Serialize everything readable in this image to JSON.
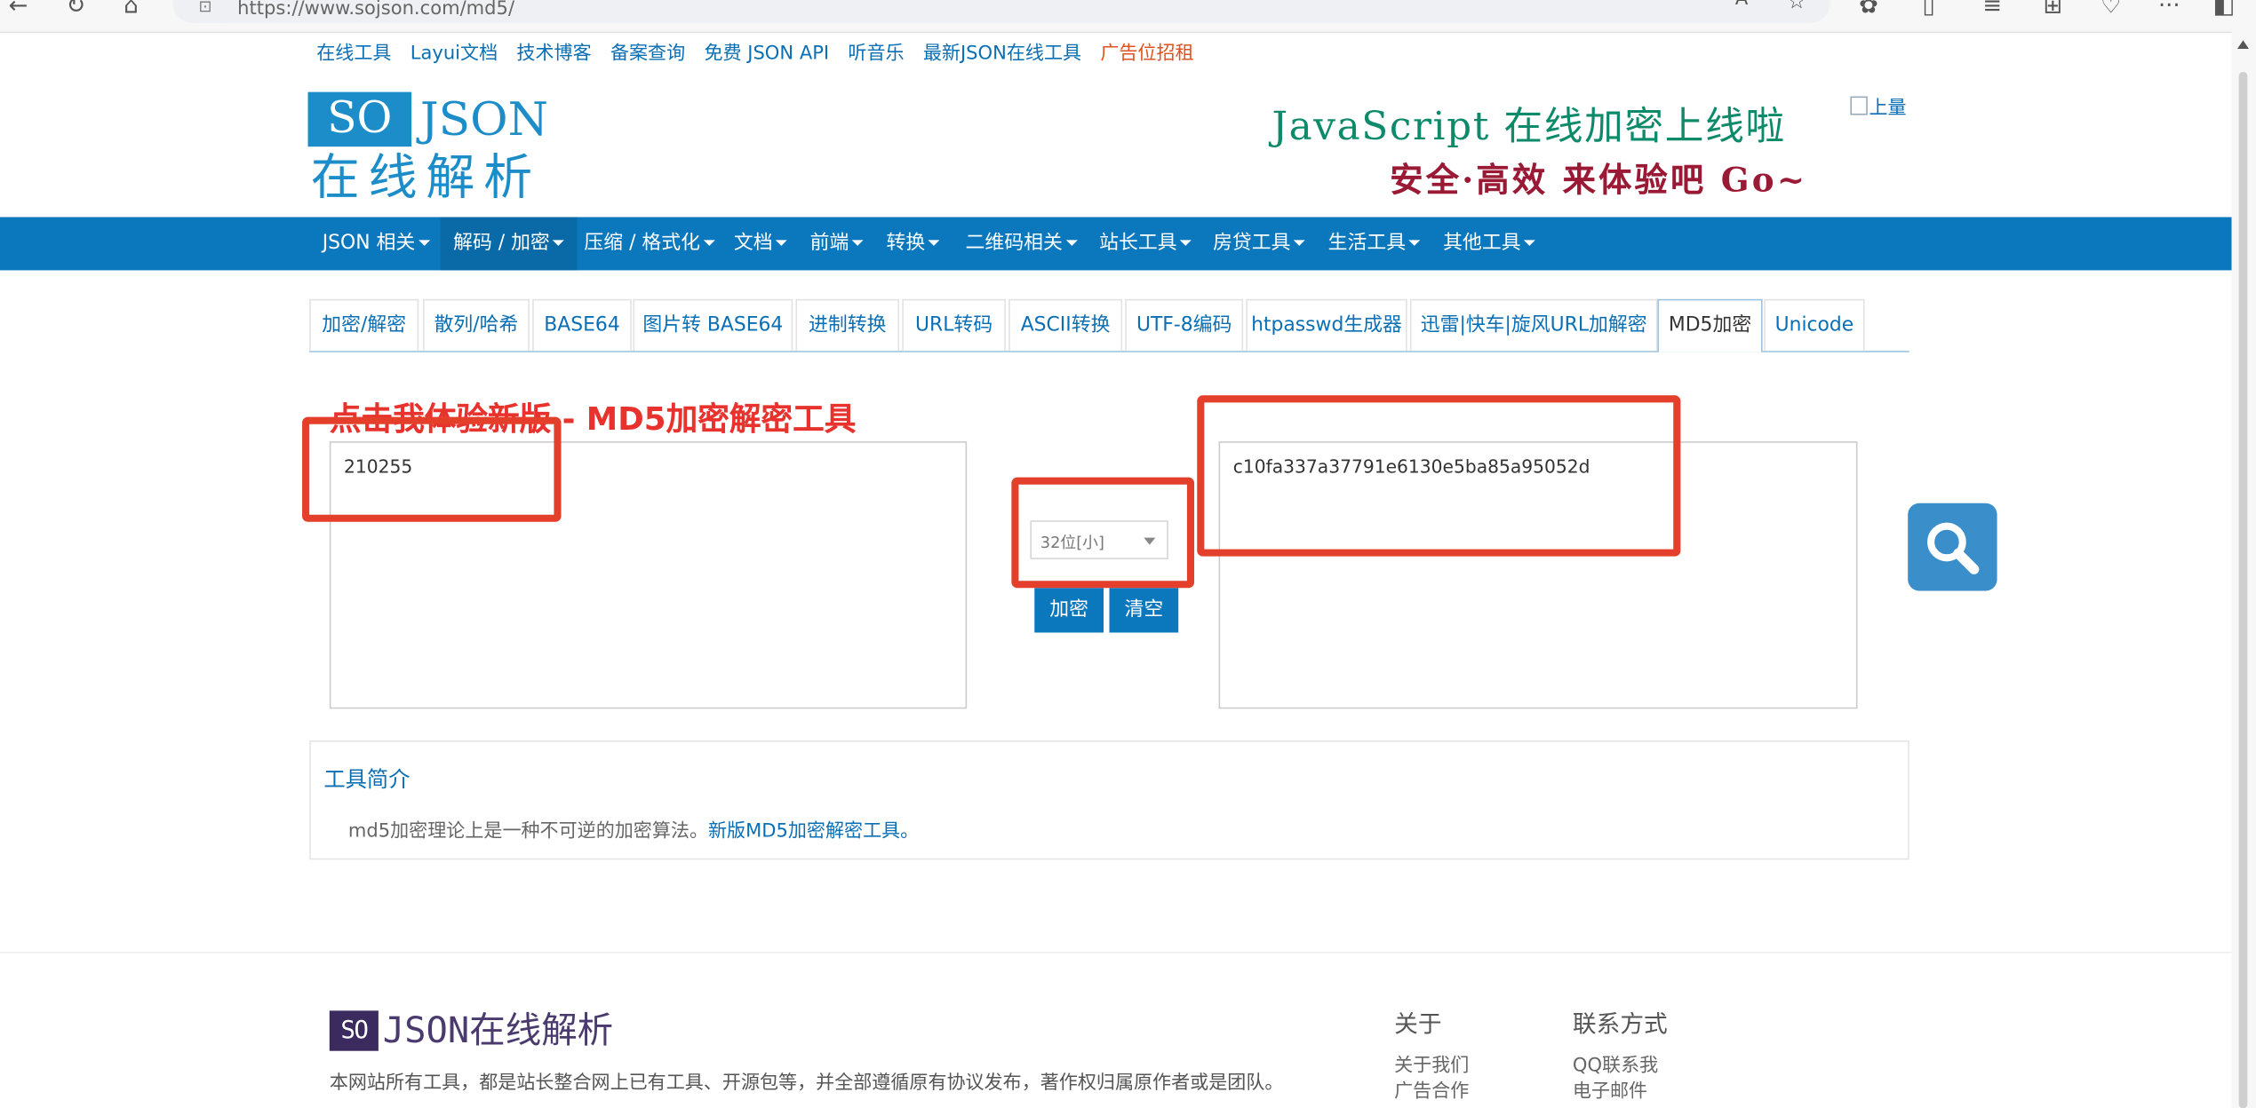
{
  "browser": {
    "url": "https://www.sojson.com/md5/"
  },
  "top_links": [
    {
      "label": "在线工具"
    },
    {
      "label": "Layui文档"
    },
    {
      "label": "技术博客"
    },
    {
      "label": "备案查询"
    },
    {
      "label": "免费 JSON API"
    },
    {
      "label": "听音乐"
    },
    {
      "label": "最新JSON在线工具"
    },
    {
      "label": "广告位招租"
    }
  ],
  "logo": {
    "so": "SO",
    "json": "JSON",
    "cn": "在线解析"
  },
  "banner": {
    "line1": "JavaScript 在线加密上线啦",
    "line2": "安全·高效 来体验吧 Go~",
    "broken_img_alt": "上量"
  },
  "nav": [
    {
      "label": "JSON 相关"
    },
    {
      "label": "解码 / 加密"
    },
    {
      "label": "压缩 / 格式化"
    },
    {
      "label": "文档"
    },
    {
      "label": "前端"
    },
    {
      "label": "转换"
    },
    {
      "label": "二维码相关"
    },
    {
      "label": "站长工具"
    },
    {
      "label": "房贷工具"
    },
    {
      "label": "生活工具"
    },
    {
      "label": "其他工具"
    }
  ],
  "tabs": [
    {
      "label": "加密/解密"
    },
    {
      "label": "散列/哈希"
    },
    {
      "label": "BASE64"
    },
    {
      "label": "图片转 BASE64"
    },
    {
      "label": "进制转换"
    },
    {
      "label": "URL转码"
    },
    {
      "label": "ASCII转换"
    },
    {
      "label": "UTF-8编码"
    },
    {
      "label": "htpasswd生成器"
    },
    {
      "label": "迅雷|快车|旋风URL加解密"
    },
    {
      "label": "MD5加密"
    },
    {
      "label": "Unicode"
    }
  ],
  "promo": "点击我体验新版 - MD5加密解密工具",
  "input_text": "210255",
  "output_text": "c10fa337a37791e6130e5ba85a95052d",
  "mode_select": "32位[小]",
  "encrypt_label": "加密",
  "clear_label": "清空",
  "intro": {
    "title": "工具简介",
    "text": "md5加密理论上是一种不可逆的加密算法。",
    "link": "新版MD5加密解密工具。"
  },
  "footer": {
    "logo_so": "SO",
    "logo_name": "JSON在线解析",
    "desc": "本网站所有工具，都是站长整合网上已有工具、开源包等，并全部遵循原有协议发布，著作权归属原作者或是团队。",
    "about_title": "关于",
    "about_links": [
      "关于我们",
      "广告合作"
    ],
    "contact_title": "联系方式",
    "contact_links": [
      "QQ联系我",
      "电子邮件"
    ]
  },
  "colors": {
    "nav_bg": "#0b78be",
    "link": "#0a6fb5",
    "annotation_red": "#e33f2b",
    "promo_red": "#e8322d"
  }
}
